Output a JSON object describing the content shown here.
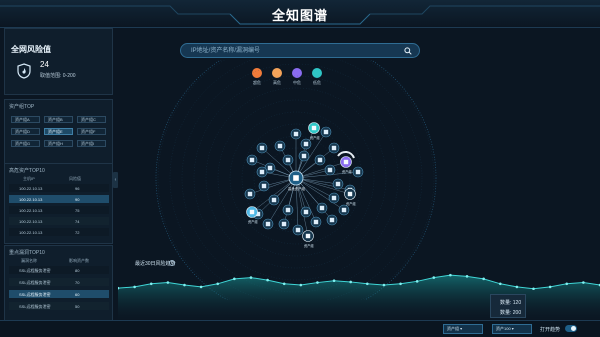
{
  "header": {
    "title": "全知图谱"
  },
  "risk": {
    "title": "全网风险值",
    "value": "24",
    "range": "取值范围: 0-200"
  },
  "asset_groups": {
    "title": "资产组TOP",
    "items": [
      "资产组A",
      "资产组B",
      "资产组C",
      "资产组D",
      "资产组E",
      "资产组F",
      "资产组G",
      "资产组H",
      "资产组I"
    ],
    "selected_index": 4
  },
  "high_risk_assets": {
    "title": "高危资产TOP10",
    "columns": [
      "主机IP",
      "风险值"
    ],
    "rows": [
      {
        "ip": "100.22.10.13",
        "value": "96"
      },
      {
        "ip": "100.22.10.13",
        "value": "90"
      },
      {
        "ip": "100.22.10.13",
        "value": "75"
      },
      {
        "ip": "100.22.10.13",
        "value": "74"
      },
      {
        "ip": "100.22.10.13",
        "value": "72"
      }
    ],
    "selected_index": 1
  },
  "vuln_top": {
    "title": "重点漏洞TOP10",
    "columns": [
      "漏洞名称",
      "影响资产数"
    ],
    "rows": [
      {
        "name": "SSL远程服务泄密",
        "value": "80"
      },
      {
        "name": "SSL远程服务泄密",
        "value": "70"
      },
      {
        "name": "SSL远程服务泄密",
        "value": "60"
      },
      {
        "name": "SSL远程服务泄密",
        "value": "50"
      }
    ],
    "selected_index": 2
  },
  "search": {
    "placeholder": "IP地址/资产名称/漏洞编号"
  },
  "legend": [
    {
      "label": "超危",
      "color": "#f07b3a"
    },
    {
      "label": "高危",
      "color": "#f3a35a"
    },
    {
      "label": "中危",
      "color": "#8a6cf0"
    },
    {
      "label": "低危",
      "color": "#2fc6c6"
    }
  ],
  "graph": {
    "center_label": "高危资产组",
    "asset_label": "资产组"
  },
  "trend": {
    "label": "最近30日风险趋势",
    "info_icon": "i",
    "points": [
      0.53,
      0.55,
      0.6,
      0.62,
      0.58,
      0.55,
      0.6,
      0.68,
      0.7,
      0.66,
      0.6,
      0.58,
      0.62,
      0.65,
      0.63,
      0.6,
      0.58,
      0.6,
      0.64,
      0.7,
      0.74,
      0.72,
      0.68,
      0.6,
      0.55,
      0.52,
      0.55,
      0.6,
      0.62,
      0.58
    ]
  },
  "stats": {
    "line1": "数量: 120",
    "line2": "数量: 200"
  },
  "footer": {
    "select1": "资产组 ▾",
    "select2": "资产100 ▾",
    "toggle_label": "打开趋势",
    "toggle_on": true
  },
  "colors": {
    "accent": "#2fa7d8",
    "bg": "#0b1622"
  }
}
